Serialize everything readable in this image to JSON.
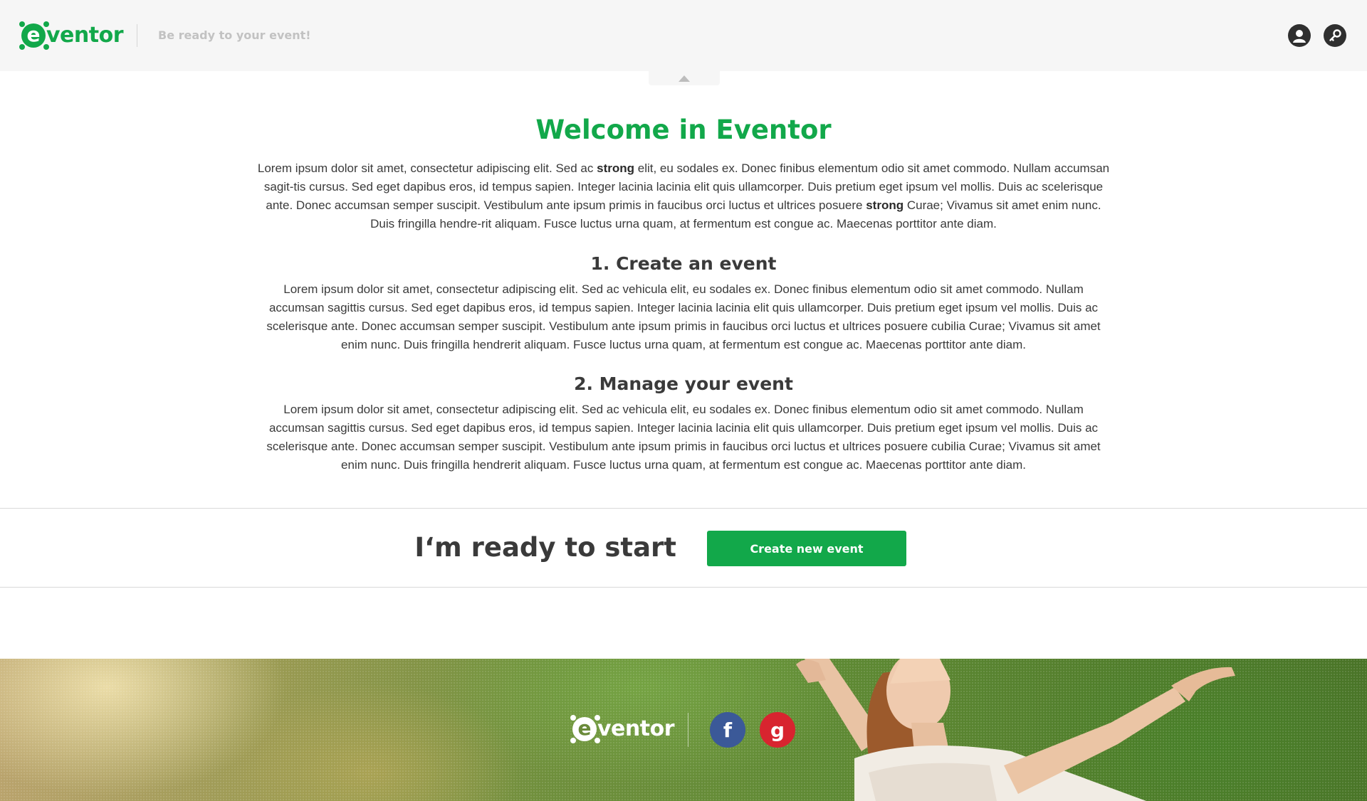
{
  "header": {
    "logo_mark": "e",
    "logo_word": "ventor",
    "tagline": "Be ready to your event!",
    "icons": [
      "user-icon",
      "key-icon"
    ]
  },
  "main": {
    "title": "Welcome in Eventor",
    "intro": {
      "t1": "Lorem ipsum dolor sit amet, consectetur adipiscing elit. Sed ac ",
      "b1": "strong",
      "t2": " elit, eu sodales ex. Donec finibus elementum odio sit amet commodo. Nullam accumsan sagit-tis cursus. Sed eget dapibus eros, id tempus sapien. Integer lacinia lacinia elit quis ullamcorper. Duis pretium eget ipsum vel mollis. Duis ac scelerisque ante. Donec accumsan semper suscipit. Vestibulum ante ipsum primis in faucibus orci luctus et ultrices posuere ",
      "b2": "strong",
      "t3": " Curae; Vivamus sit amet enim nunc. Duis fringilla hendre-rit aliquam. Fusce luctus urna quam, at fermentum est congue ac. Maecenas porttitor ante diam."
    },
    "sections": [
      {
        "title": "1. Create an event",
        "body": "Lorem ipsum dolor sit amet, consectetur adipiscing elit. Sed ac vehicula elit, eu sodales ex. Donec finibus elementum odio sit amet commodo. Nullam accumsan sagittis cursus. Sed eget dapibus eros, id tempus sapien. Integer lacinia lacinia elit quis ullamcorper. Duis pretium eget ipsum vel mollis. Duis ac scelerisque ante. Donec accumsan semper suscipit. Vestibulum ante ipsum primis in faucibus orci luctus et ultrices posuere cubilia Curae; Vivamus sit amet enim nunc. Duis fringilla hendrerit aliquam. Fusce luctus urna quam, at fermentum est congue ac. Maecenas porttitor ante diam."
      },
      {
        "title": "2. Manage your event",
        "body": "Lorem ipsum dolor sit amet, consectetur adipiscing elit. Sed ac vehicula elit, eu sodales ex. Donec finibus elementum odio sit amet commodo. Nullam accumsan sagittis cursus. Sed eget dapibus eros, id tempus sapien. Integer lacinia lacinia elit quis ullamcorper. Duis pretium eget ipsum vel mollis. Duis ac scelerisque ante. Donec accumsan semper suscipit. Vestibulum ante ipsum primis in faucibus orci luctus et ultrices posuere cubilia Curae; Vivamus sit amet enim nunc. Duis fringilla hendrerit aliquam. Fusce luctus urna quam, at fermentum est congue ac. Maecenas porttitor ante diam."
      }
    ]
  },
  "cta": {
    "text": "I‘m ready to start",
    "button_label": "Create new event"
  },
  "footer": {
    "logo_mark": "e",
    "logo_word": "ventor",
    "social": [
      {
        "name": "facebook-icon",
        "glyph": "f"
      },
      {
        "name": "google-icon",
        "glyph": "g"
      }
    ]
  },
  "colors": {
    "brand_green": "#12a84a",
    "text_dark": "#3a3a3a",
    "header_bg": "#f6f6f6",
    "facebook_blue": "#3b5998",
    "google_red": "#d8242f"
  }
}
